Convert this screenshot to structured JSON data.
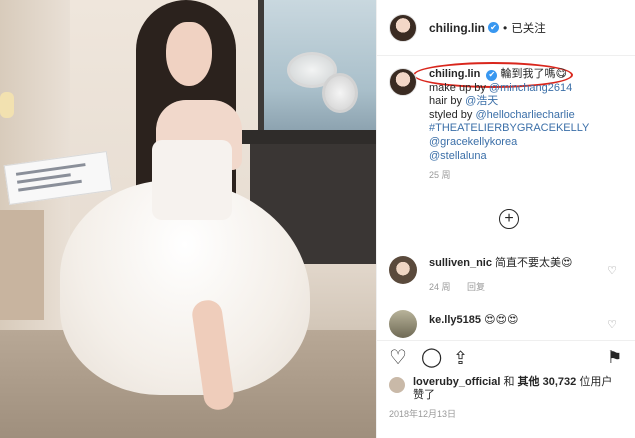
{
  "post": {
    "username": "chiling.lin",
    "follow_status": "已关注",
    "verified_glyph": "✔",
    "header_separator": "•"
  },
  "caption": {
    "username": "chiling.lin",
    "title_text": "輪到我了嗎😋",
    "line1_prefix": "make up by ",
    "line1_mention": "@minchang2614",
    "line2_prefix": "hair by ",
    "line2_mention": "@浩天",
    "line3_prefix": "styled by ",
    "line3_mention": "@hellocharliecharlie",
    "hashtag": "#THEATELIERBYGRACEKELLY",
    "mention4": "@gracekellykorea",
    "mention5": "@stellaluna",
    "time": "25 周"
  },
  "load_more_glyph": "+",
  "comments": [
    {
      "username": "sulliven_nic",
      "text": "简直不要太美😍",
      "time": "24 周",
      "reply": "回复",
      "heart": "♡",
      "avatar_color": "#d7c7b3"
    },
    {
      "username": "ke.lly5185",
      "text": "😍😍😍",
      "time": "",
      "reply": "",
      "heart": "♡",
      "avatar_color": "#8a8a70"
    }
  ],
  "actions": {
    "like_icon": "♡",
    "comment_icon": "◯",
    "share_icon": "⇪",
    "bookmark_icon": "⚑"
  },
  "likes": {
    "liker": "loveruby_official",
    "connector": " 和 ",
    "others_prefix": "其他 ",
    "count": "30,732",
    "suffix": " 位用户",
    "line2": "赞了"
  },
  "date": "2018年12月13日",
  "colors": {
    "accent_blue": "#3897f0",
    "link": "#3b6fa8",
    "annotation_red": "#d9261c",
    "muted": "#999999"
  }
}
